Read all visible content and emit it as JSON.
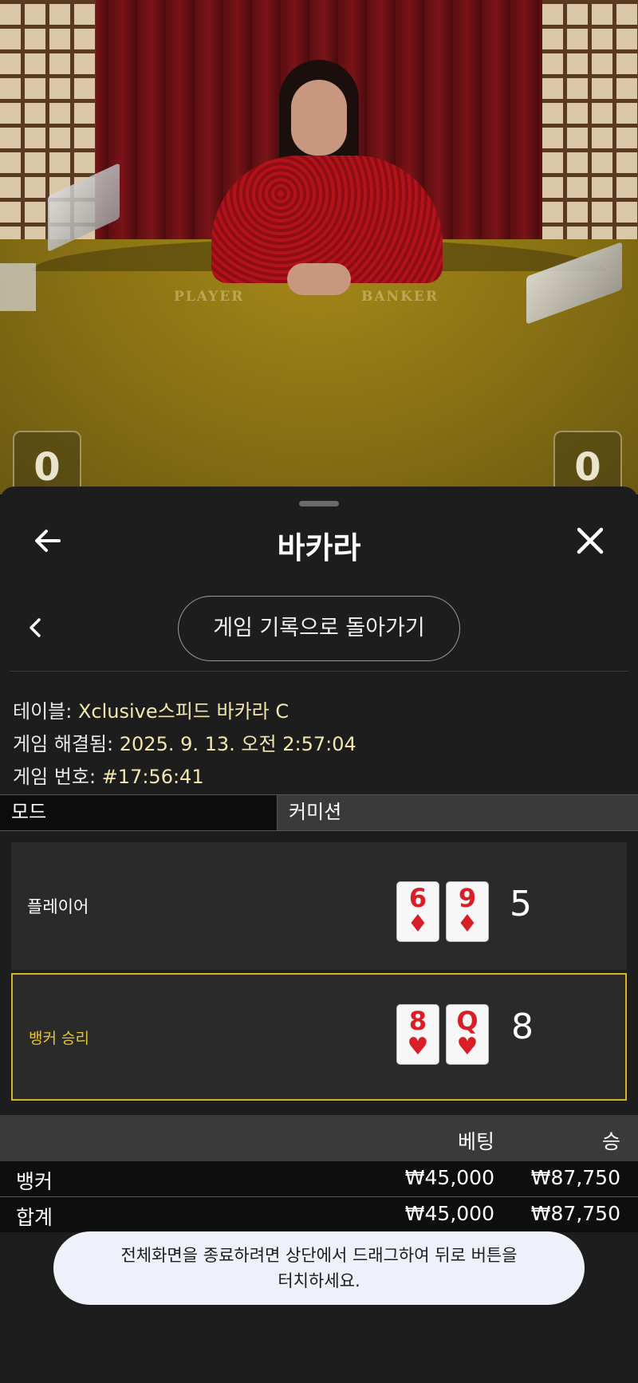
{
  "video": {
    "felt_player": "PLAYER",
    "felt_banker": "BANKER",
    "player_score_tile": "0",
    "banker_score_tile": "0"
  },
  "header": {
    "title": "바카라",
    "back_icon": "arrow-left-icon",
    "close_icon": "close-icon"
  },
  "nav": {
    "history_button": "게임 기록으로 돌아가기",
    "back_icon": "chevron-left-icon"
  },
  "info": {
    "table_label": "테이블:",
    "table_value": "Xclusive스피드 바카라 C",
    "resolved_label": "게임 해결됨:",
    "resolved_value": "2025. 9. 13. 오전 2:57:04",
    "number_label": "게임 번호:",
    "number_value": "#17:56:41"
  },
  "mode": {
    "left": "모드",
    "right": "커미션"
  },
  "hands": {
    "player": {
      "label": "플레이어",
      "cards": [
        {
          "rank": "6",
          "suit": "♦"
        },
        {
          "rank": "9",
          "suit": "♦"
        }
      ],
      "score": "5"
    },
    "banker": {
      "label": "뱅커 승리",
      "cards": [
        {
          "rank": "8",
          "suit": "♥"
        },
        {
          "rank": "Q",
          "suit": "♥"
        }
      ],
      "score": "8"
    }
  },
  "bets": {
    "headers": {
      "bet": "베팅",
      "win": "승"
    },
    "rows": [
      {
        "name": "뱅커",
        "bet": "₩45,000",
        "win": "₩87,750"
      }
    ],
    "total": {
      "name": "합계",
      "bet": "₩45,000",
      "win": "₩87,750"
    }
  },
  "toast": {
    "line1": "전체화면을 종료하려면 상단에서 드래그하여 뒤로 버튼을",
    "line2": "터치하세요."
  },
  "colors": {
    "sheet_bg": "#1d1d1d",
    "winner_accent": "#d6b524",
    "info_value": "#f3e7b0",
    "card_red": "#d81e26"
  }
}
